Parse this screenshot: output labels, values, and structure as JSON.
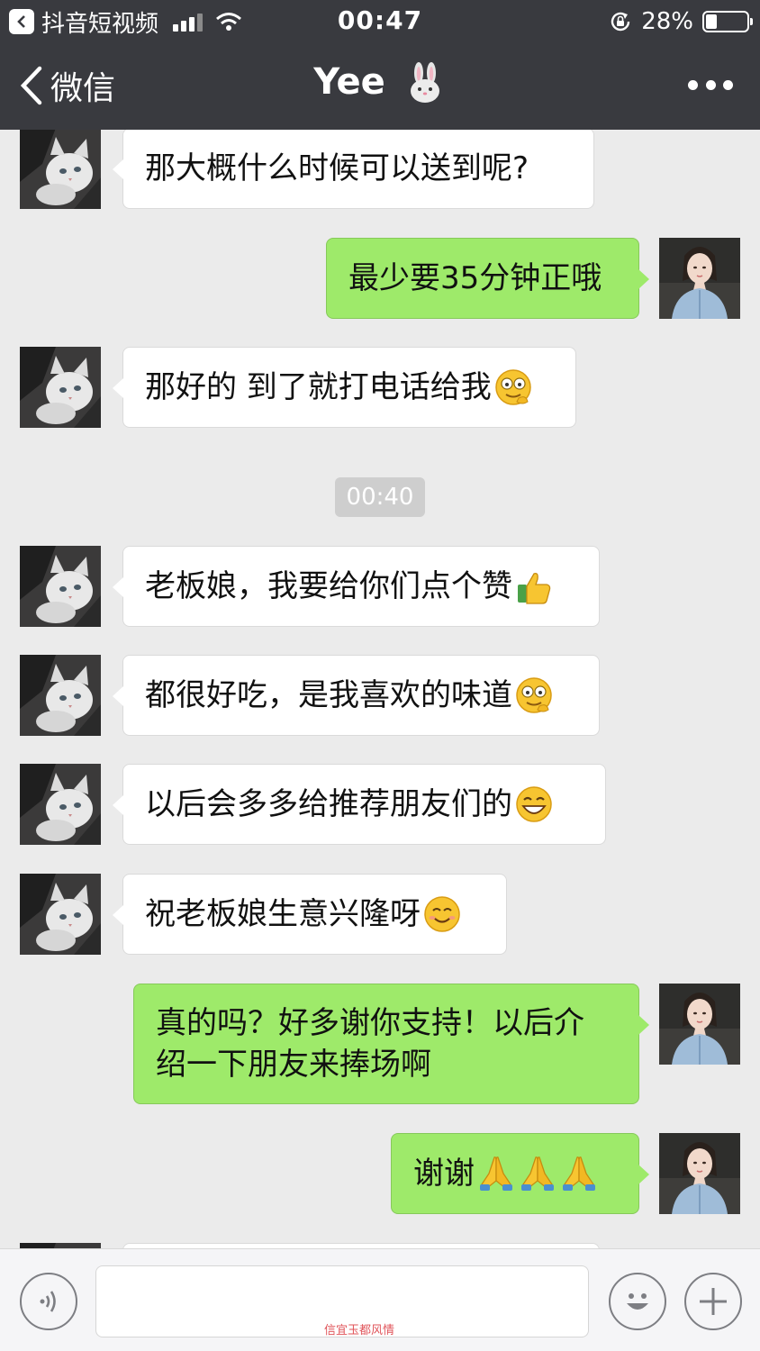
{
  "status_bar": {
    "back_app_label": "抖音短视频",
    "time": "00:47",
    "battery_text": "28%",
    "battery_level": 0.28
  },
  "nav": {
    "back_label": "微信",
    "title": "Yee"
  },
  "messages": [
    {
      "side": "in",
      "text": "那大概什么时候可以送到呢?"
    },
    {
      "side": "out",
      "text": "最少要35分钟正哦"
    },
    {
      "side": "in",
      "text": "那好的 到了就打电话给我",
      "emoji": "grin-emoji"
    },
    {
      "type": "time",
      "text": "00:40"
    },
    {
      "side": "in",
      "text": "老板娘，我要给你们点个赞",
      "emoji": "thumbs-up-emoji"
    },
    {
      "side": "in",
      "text": "都很好吃，是我喜欢的味道",
      "emoji": "grin-emoji"
    },
    {
      "side": "in",
      "text": "以后会多多给推荐朋友们的",
      "emoji": "big-smile-emoji"
    },
    {
      "side": "in",
      "text": "祝老板娘生意兴隆呀",
      "emoji": "smile-emoji"
    },
    {
      "side": "out",
      "text_line1": "真的吗？好多谢你支持！以后介",
      "text_line2": "绍一下朋友来捧场啊"
    },
    {
      "side": "out",
      "text": "谢谢",
      "emoji": "pray-emoji"
    }
  ],
  "input": {
    "voice_icon": "voice-icon",
    "emoji_icon": "emoji-face-icon",
    "plus_icon": "plus-icon"
  },
  "watermark": "信宜玉都风情",
  "colors": {
    "bar": "#393a3f",
    "chat_bg": "#ebebeb",
    "out_bubble": "#9eea6a",
    "in_bubble": "#ffffff"
  }
}
